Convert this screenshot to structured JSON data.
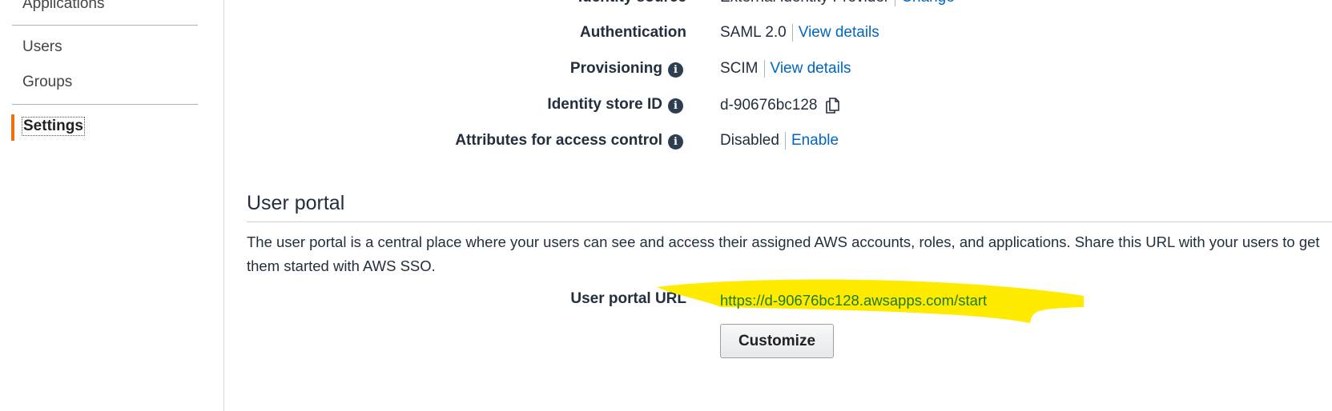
{
  "sidebar": {
    "items": [
      {
        "label": "Applications"
      },
      {
        "label": "Users"
      },
      {
        "label": "Groups"
      },
      {
        "label": "Settings",
        "active": true
      }
    ]
  },
  "details": {
    "identity_source": {
      "label": "Identity source",
      "value": "External identity Provider",
      "action": "Change"
    },
    "authentication": {
      "label": "Authentication",
      "value": "SAML 2.0",
      "action": "View details"
    },
    "provisioning": {
      "label": "Provisioning",
      "value": "SCIM",
      "action": "View details"
    },
    "identity_store_id": {
      "label": "Identity store ID",
      "value": "d-90676bc128"
    },
    "abac": {
      "label": "Attributes for access control",
      "value": "Disabled",
      "action": "Enable"
    }
  },
  "user_portal": {
    "title": "User portal",
    "description": "The user portal is a central place where your users can see and access their assigned AWS accounts, roles, and applications. Share this URL with your users to get them started with AWS SSO.",
    "url_label": "User portal URL",
    "url": "https://d-90676bc128.awsapps.com/start",
    "customize_label": "Customize"
  },
  "colors": {
    "accent": "#ec7211",
    "link": "#0066c0",
    "highlight": "#ffeb00",
    "url_text": "#1f7a1f"
  }
}
